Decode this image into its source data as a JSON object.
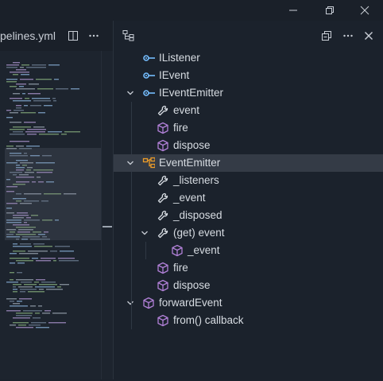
{
  "window": {
    "controls": [
      {
        "name": "minimize-icon"
      },
      {
        "name": "restore-icon"
      },
      {
        "name": "close-icon"
      }
    ]
  },
  "editor": {
    "tab_label": "pelines.yml",
    "actions": [
      "split-editor-icon",
      "more-actions-icon"
    ]
  },
  "outline": {
    "header_icon": "outline-tree-icon",
    "header_actions": [
      "collapse-all-icon",
      "more-actions-icon",
      "close-icon"
    ],
    "items": [
      {
        "label": "IListener",
        "kind": "interface",
        "icon": "interface-icon",
        "expandable": false
      },
      {
        "label": "IEvent",
        "kind": "interface",
        "icon": "interface-icon",
        "expandable": false
      },
      {
        "label": "IEventEmitter",
        "kind": "interface",
        "icon": "interface-icon",
        "expandable": true,
        "expanded": true
      },
      {
        "label": "event",
        "kind": "property",
        "icon": "property-icon",
        "expandable": false
      },
      {
        "label": "fire",
        "kind": "method",
        "icon": "method-icon",
        "expandable": false
      },
      {
        "label": "dispose",
        "kind": "method",
        "icon": "method-icon",
        "expandable": false
      },
      {
        "label": "EventEmitter",
        "kind": "class",
        "icon": "class-icon",
        "expandable": true,
        "expanded": true,
        "selected": true
      },
      {
        "label": "_listeners",
        "kind": "property",
        "icon": "property-icon",
        "expandable": false
      },
      {
        "label": "_event",
        "kind": "property",
        "icon": "property-icon",
        "expandable": false
      },
      {
        "label": "_disposed",
        "kind": "property",
        "icon": "property-icon",
        "expandable": false
      },
      {
        "label": "(get) event",
        "kind": "property",
        "icon": "property-icon",
        "expandable": true,
        "expanded": true
      },
      {
        "label": "_event",
        "kind": "method",
        "icon": "method-icon",
        "expandable": false
      },
      {
        "label": "fire",
        "kind": "method",
        "icon": "method-icon",
        "expandable": false
      },
      {
        "label": "dispose",
        "kind": "method",
        "icon": "method-icon",
        "expandable": false
      },
      {
        "label": "forwardEvent",
        "kind": "function",
        "icon": "function-icon",
        "expandable": true,
        "expanded": true
      },
      {
        "label": "from() callback",
        "kind": "method",
        "icon": "method-icon",
        "expandable": false
      }
    ]
  },
  "colors": {
    "interface": "#75beff",
    "method": "#b180d7",
    "class": "#ee9d28",
    "property": "#d7dce2",
    "selected_row": "#343b46"
  }
}
